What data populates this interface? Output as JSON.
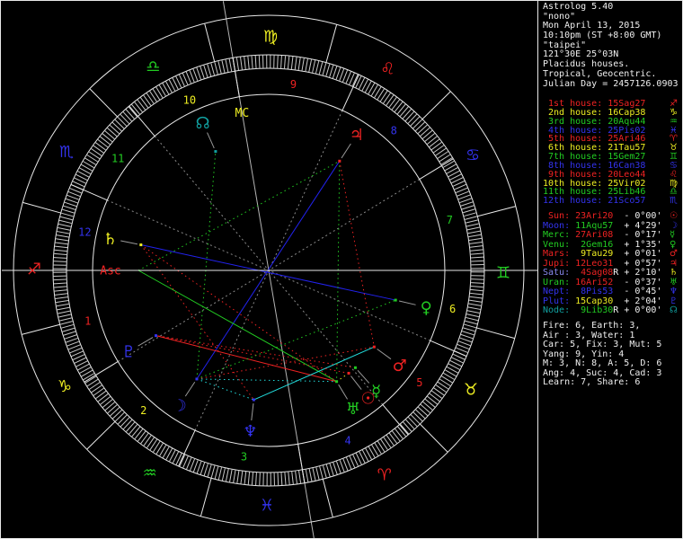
{
  "app_title": "Astrolog 5.40",
  "colors": {
    "red": "#ee2222",
    "yellow": "#eeee22",
    "green": "#22cc22",
    "blue": "#3333ee",
    "paleblue": "#8888ee",
    "teal": "#11a0a0",
    "white": "#f0f0f0",
    "cyan": "#22dddd",
    "ring": "#e8e8e8",
    "tick": "#c8c8c8",
    "cuspline": "#8a8a8a",
    "axis": "#b4b4b4",
    "pointer": "#999999",
    "aspect_blue": "#2222ee",
    "aspect_green": "#22cc22",
    "aspect_red": "#ee2222",
    "aspect_cyan": "#22dddd",
    "aspect_yellow": "#eeee22"
  },
  "info": {
    "header_lines": [
      "Astrolog 5.40",
      "\"nono\"",
      "Mon April 13, 2015",
      "10:10pm (ST +8:00 GMT)",
      "\"taipei\"",
      "121°30E 25°03N",
      "Placidus houses.",
      "Tropical, Geocentric.",
      "Julian Day = 2457126.0903"
    ],
    "houses": [
      {
        "label": " 1st house:",
        "value": "15Sag27",
        "glyph": "♐",
        "color": "#ee2222"
      },
      {
        "label": " 2nd house:",
        "value": "16Cap38",
        "glyph": "♑",
        "color": "#eeee22"
      },
      {
        "label": " 3rd house:",
        "value": "20Aqu44",
        "glyph": "♒",
        "color": "#22cc22"
      },
      {
        "label": " 4th house:",
        "value": "25Pis02",
        "glyph": "♓",
        "color": "#3333ee"
      },
      {
        "label": " 5th house:",
        "value": "25Ari46",
        "glyph": "♈",
        "color": "#ee2222"
      },
      {
        "label": " 6th house:",
        "value": "21Tau57",
        "glyph": "♉",
        "color": "#eeee22"
      },
      {
        "label": " 7th house:",
        "value": "15Gem27",
        "glyph": "♊",
        "color": "#22cc22"
      },
      {
        "label": " 8th house:",
        "value": "16Can38",
        "glyph": "♋",
        "color": "#3333ee"
      },
      {
        "label": " 9th house:",
        "value": "20Leo44",
        "glyph": "♌",
        "color": "#ee2222"
      },
      {
        "label": "10th house:",
        "value": "25Vir02",
        "glyph": "♍",
        "color": "#eeee22"
      },
      {
        "label": "11th house:",
        "value": "25Lib46",
        "glyph": "♎",
        "color": "#22cc22"
      },
      {
        "label": "12th house:",
        "value": "21Sco57",
        "glyph": "♏",
        "color": "#3333ee"
      }
    ],
    "planets": [
      {
        "name": " Sun:",
        "value": " 23Ari20",
        "retro": " ",
        "dev": "- 0°00'",
        "glyph": "☉",
        "name_color": "#ee2222",
        "value_color": "#ee2222",
        "glyph_color": "#ee2222"
      },
      {
        "name": "Moon:",
        "value": " 11Aqu57",
        "retro": " ",
        "dev": "+ 4°29'",
        "glyph": "☽",
        "name_color": "#3333ee",
        "value_color": "#22cc22",
        "glyph_color": "#3333ee"
      },
      {
        "name": "Merc:",
        "value": " 27Ari08",
        "retro": " ",
        "dev": "- 0°17'",
        "glyph": "☿",
        "name_color": "#22cc22",
        "value_color": "#ee2222",
        "glyph_color": "#22cc22"
      },
      {
        "name": "Venu:",
        "value": "  2Gem16",
        "retro": " ",
        "dev": "+ 1°35'",
        "glyph": "♀",
        "name_color": "#22cc22",
        "value_color": "#22cc22",
        "glyph_color": "#22cc22"
      },
      {
        "name": "Mars:",
        "value": "  9Tau29",
        "retro": " ",
        "dev": "+ 0°01'",
        "glyph": "♂",
        "name_color": "#ee2222",
        "value_color": "#eeee22",
        "glyph_color": "#ee2222"
      },
      {
        "name": "Jupi:",
        "value": " 12Leo31",
        "retro": " ",
        "dev": "+ 0°57'",
        "glyph": "♃",
        "name_color": "#ee2222",
        "value_color": "#ee2222",
        "glyph_color": "#ee2222"
      },
      {
        "name": "Satu:",
        "value": "  4Sag08",
        "retro": "R",
        "dev": "+ 2°10'",
        "glyph": "♄",
        "name_color": "#8888ee",
        "value_color": "#ee2222",
        "glyph_color": "#eeee22"
      },
      {
        "name": "Uran:",
        "value": " 16Ari52",
        "retro": " ",
        "dev": "- 0°37'",
        "glyph": "♅",
        "name_color": "#22cc22",
        "value_color": "#ee2222",
        "glyph_color": "#22cc22"
      },
      {
        "name": "Nept:",
        "value": "  8Pis53",
        "retro": " ",
        "dev": "- 0°45'",
        "glyph": "♆",
        "name_color": "#3333ee",
        "value_color": "#3333ee",
        "glyph_color": "#3333ee"
      },
      {
        "name": "Plut:",
        "value": " 15Cap30",
        "retro": " ",
        "dev": "+ 2°04'",
        "glyph": "♇",
        "name_color": "#3333ee",
        "value_color": "#eeee22",
        "glyph_color": "#3333ee"
      },
      {
        "name": "Node:",
        "value": "  9Lib30",
        "retro": "R",
        "dev": "+ 0°00'",
        "glyph": "☊",
        "name_color": "#11a0a0",
        "value_color": "#22cc22",
        "glyph_color": "#11a0a0"
      }
    ],
    "stats_lines": [
      "Fire: 6, Earth: 3,",
      "Air : 3, Water: 1",
      "Car: 5, Fix: 3, Mut: 5",
      "Yang: 9, Yin: 4",
      "M: 3, N: 8, A: 5, D: 6",
      "Ang: 4, Suc: 4, Cad: 3",
      "Learn: 7, Share: 6"
    ]
  },
  "wheel": {
    "asc_label": "Asc",
    "mc_label": "MC",
    "asc_lon": 255.45,
    "mc_lon": 175.033,
    "signs": [
      {
        "name": "aries",
        "glyph": "♈",
        "color": "#ee2222"
      },
      {
        "name": "taurus",
        "glyph": "♉",
        "color": "#eeee22"
      },
      {
        "name": "gemini",
        "glyph": "♊",
        "color": "#22cc22"
      },
      {
        "name": "cancer",
        "glyph": "♋",
        "color": "#3333ee"
      },
      {
        "name": "leo",
        "glyph": "♌",
        "color": "#ee2222"
      },
      {
        "name": "virgo",
        "glyph": "♍",
        "color": "#eeee22"
      },
      {
        "name": "libra",
        "glyph": "♎",
        "color": "#22cc22"
      },
      {
        "name": "scorpio",
        "glyph": "♏",
        "color": "#3333ee"
      },
      {
        "name": "sagittarius",
        "glyph": "♐",
        "color": "#ee2222"
      },
      {
        "name": "capricorn",
        "glyph": "♑",
        "color": "#eeee22"
      },
      {
        "name": "aquarius",
        "glyph": "♒",
        "color": "#22cc22"
      },
      {
        "name": "pisces",
        "glyph": "♓",
        "color": "#3333ee"
      }
    ],
    "cusps": [
      255.45,
      286.633,
      320.733,
      355.033,
      25.767,
      51.95,
      75.45,
      106.633,
      140.733,
      175.033,
      205.767,
      231.95
    ],
    "house_number_colors": [
      "#ee2222",
      "#eeee22",
      "#22cc22",
      "#3333ee",
      "#ee2222",
      "#eeee22",
      "#22cc22",
      "#3333ee",
      "#ee2222",
      "#eeee22",
      "#22cc22",
      "#3333ee"
    ],
    "planets": [
      {
        "name": "sun",
        "glyph": "☉",
        "lon": 23.333,
        "color": "#ee2222"
      },
      {
        "name": "moon",
        "glyph": "☽",
        "lon": 311.95,
        "color": "#3333ee"
      },
      {
        "name": "mercury",
        "glyph": "☿",
        "lon": 27.133,
        "color": "#22cc22"
      },
      {
        "name": "venus",
        "glyph": "♀",
        "lon": 62.267,
        "color": "#22cc22"
      },
      {
        "name": "mars",
        "glyph": "♂",
        "lon": 39.483,
        "color": "#ee2222"
      },
      {
        "name": "jupiter",
        "glyph": "♃",
        "lon": 132.517,
        "color": "#ee2222"
      },
      {
        "name": "saturn",
        "glyph": "♄",
        "lon": 244.133,
        "color": "#eeee22"
      },
      {
        "name": "uranus",
        "glyph": "♅",
        "lon": 16.867,
        "color": "#22cc22"
      },
      {
        "name": "neptune",
        "glyph": "♆",
        "lon": 338.883,
        "color": "#3333ee"
      },
      {
        "name": "pluto",
        "glyph": "♇",
        "lon": 285.5,
        "color": "#3333ee"
      },
      {
        "name": "node",
        "glyph": "☊",
        "lon": 189.5,
        "color": "#11a0a0"
      }
    ],
    "aspects": [
      {
        "a": "moon",
        "b": "jupiter",
        "color": "#2222ee",
        "dotted": false
      },
      {
        "a": "venus",
        "b": "saturn",
        "color": "#2222ee",
        "dotted": false
      },
      {
        "a": "asc",
        "b": "uranus",
        "color": "#22cc22",
        "dotted": false
      },
      {
        "a": "uranus",
        "b": "pluto",
        "color": "#ee2222",
        "dotted": false
      },
      {
        "a": "mars",
        "b": "neptune",
        "color": "#22dddd",
        "dotted": false
      },
      {
        "a": "jupiter",
        "b": "uranus",
        "color": "#22cc22",
        "dotted": true
      },
      {
        "a": "moon",
        "b": "uranus",
        "color": "#22dddd",
        "dotted": true
      },
      {
        "a": "moon",
        "b": "neptune",
        "color": "#22dddd",
        "dotted": true
      },
      {
        "a": "saturn",
        "b": "neptune",
        "color": "#ee2222",
        "dotted": true
      },
      {
        "a": "saturn",
        "b": "uranus",
        "color": "#ee2222",
        "dotted": true
      },
      {
        "a": "sun",
        "b": "pluto",
        "color": "#ee2222",
        "dotted": true
      },
      {
        "a": "mercury",
        "b": "pluto",
        "color": "#ee2222",
        "dotted": true
      },
      {
        "a": "jupiter",
        "b": "mars",
        "color": "#ee2222",
        "dotted": true
      },
      {
        "a": "moon",
        "b": "mars",
        "color": "#ee2222",
        "dotted": true
      },
      {
        "a": "moon",
        "b": "node",
        "color": "#22cc22",
        "dotted": true
      },
      {
        "a": "moon",
        "b": "venus",
        "color": "#22cc22",
        "dotted": true
      },
      {
        "a": "asc",
        "b": "jupiter",
        "color": "#22cc22",
        "dotted": true
      },
      {
        "a": "sun",
        "b": "uranus",
        "color": "#eeee22",
        "dotted": true
      }
    ]
  }
}
